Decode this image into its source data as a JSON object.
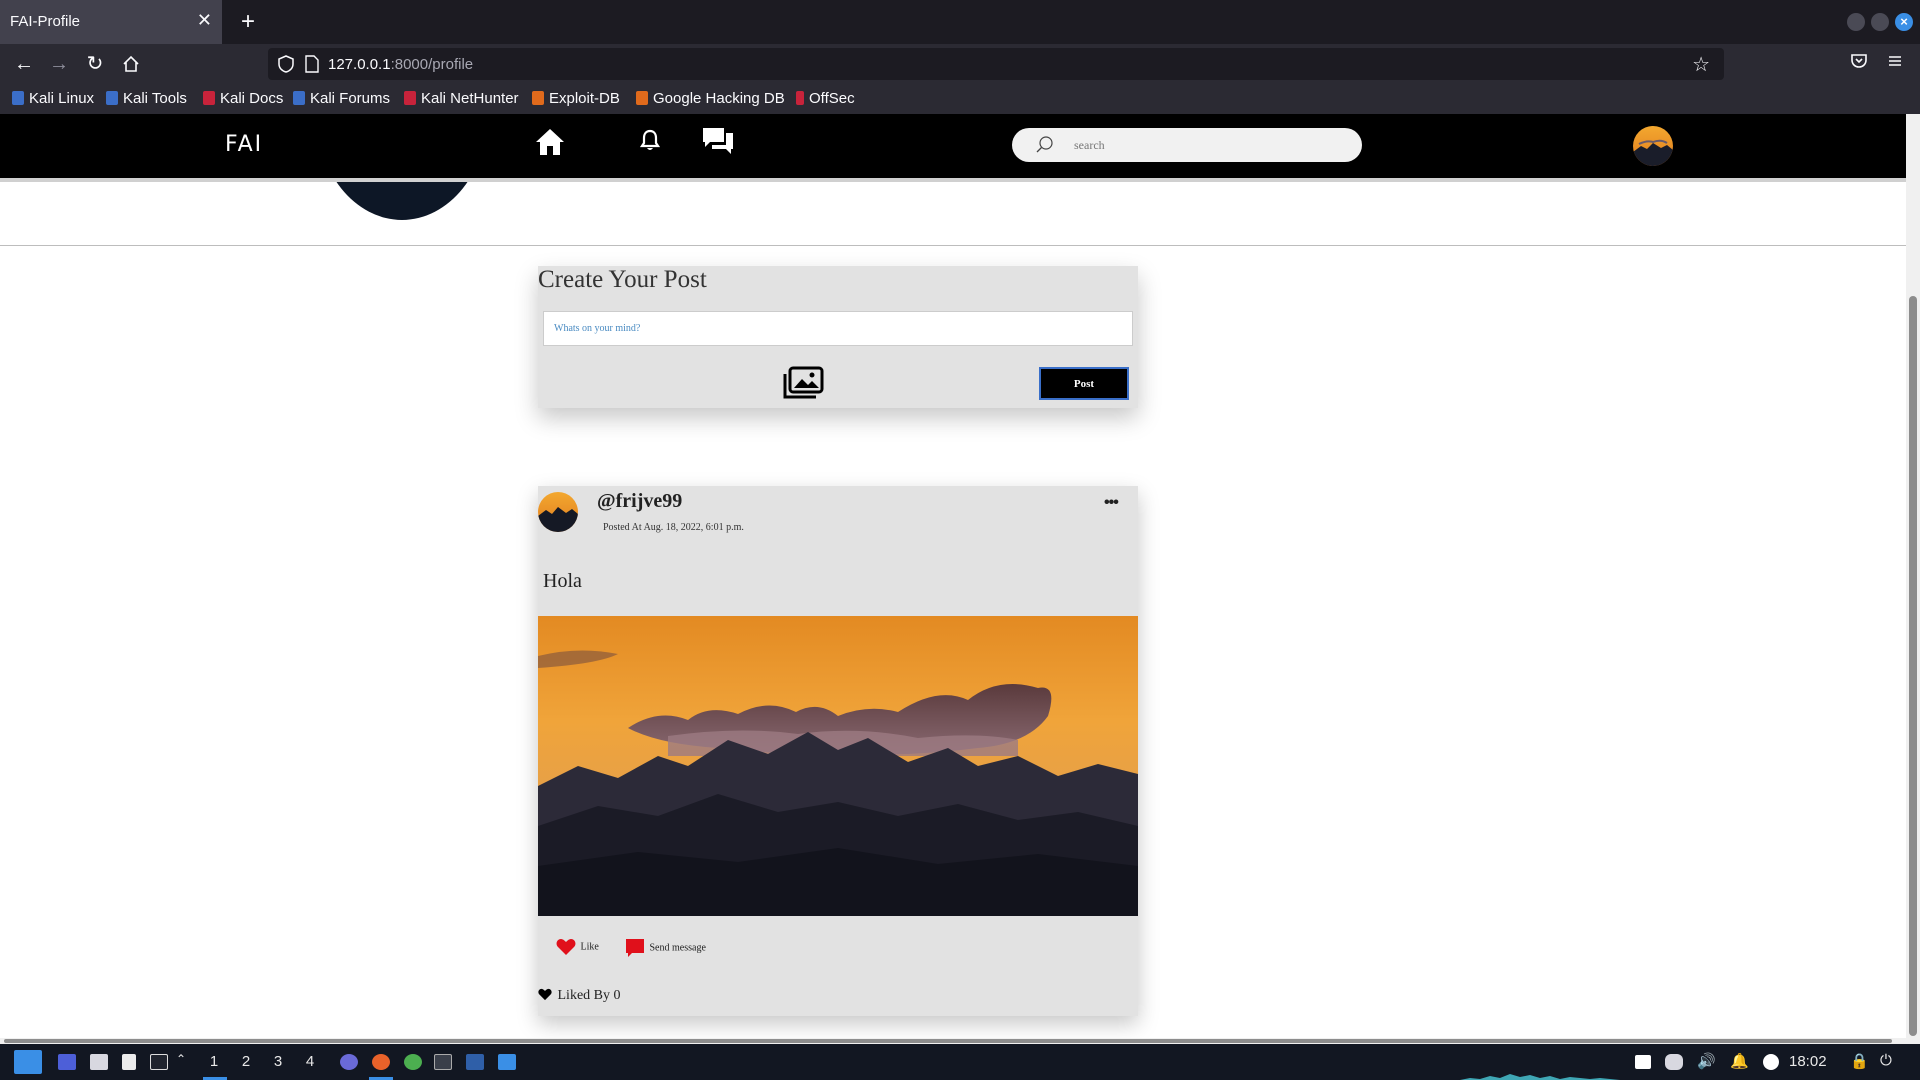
{
  "browser": {
    "tab_title": "FAI-Profile",
    "url_host": "127.0.0.1",
    "url_path": ":8000/profile",
    "bookmarks": [
      "Kali Linux",
      "Kali Tools",
      "Kali Docs",
      "Kali Forums",
      "Kali NetHunter",
      "Exploit-DB",
      "Google Hacking DB",
      "OffSec"
    ]
  },
  "header": {
    "logo": "FAI",
    "search_placeholder": "search"
  },
  "create_post": {
    "title": "Create Your Post",
    "input_placeholder": "Whats on your mind?",
    "post_button": "Post"
  },
  "post": {
    "username": "@frijve99",
    "posted_at": "Posted At Aug. 18, 2022, 6:01 p.m.",
    "text": "Hola",
    "like_label": "Like",
    "message_label": "Send message",
    "liked_by": "Liked By 0"
  },
  "taskbar": {
    "workspaces": [
      "1",
      "2",
      "3",
      "4"
    ],
    "time": "18:02"
  },
  "colors": {
    "accent": "#3a8fe6",
    "like_red": "#e0101b",
    "header_black": "#000000",
    "card_gray": "#e2e2e2"
  }
}
